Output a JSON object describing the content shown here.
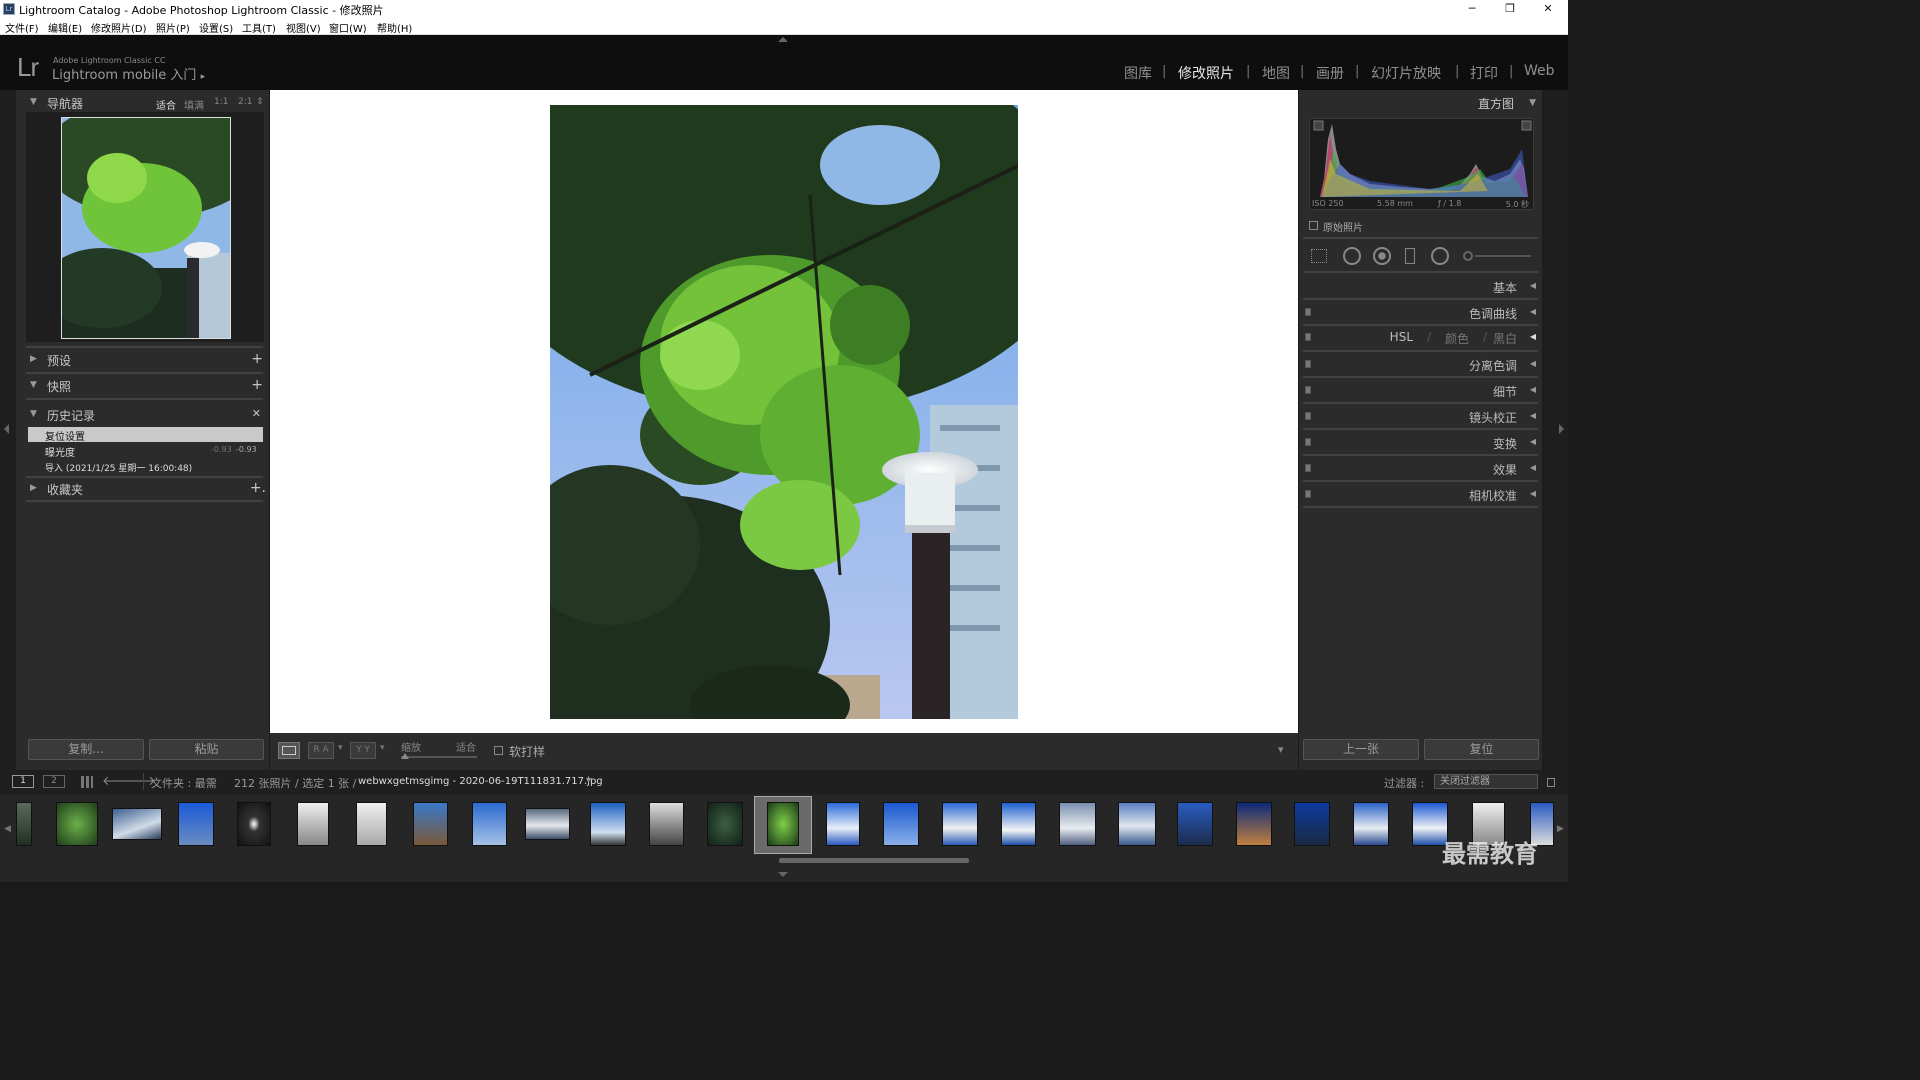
{
  "window": {
    "title": "Lightroom Catalog - Adobe Photoshop Lightroom Classic - 修改照片",
    "icon": "Lr",
    "min": "─",
    "restore": "❐",
    "close": "✕"
  },
  "menu": [
    "文件(F)",
    "编辑(E)",
    "修改照片(D)",
    "照片(P)",
    "设置(S)",
    "工具(T)",
    "视图(V)",
    "窗口(W)",
    "帮助(H)"
  ],
  "identity": {
    "logo": "Lr",
    "line1": "Adobe Lightroom Classic CC",
    "line2": "Lightroom mobile 入门",
    "arrow": "▸"
  },
  "modules": [
    {
      "label": "图库",
      "active": false
    },
    {
      "label": "修改照片",
      "active": true
    },
    {
      "label": "地图",
      "active": false
    },
    {
      "label": "画册",
      "active": false
    },
    {
      "label": "幻灯片放映",
      "active": false
    },
    {
      "label": "打印",
      "active": false
    },
    {
      "label": "Web",
      "active": false
    }
  ],
  "module_sep": "|",
  "navigator": {
    "title": "导航器",
    "zoom": [
      "适合",
      "填满",
      "1:1",
      "2:1"
    ],
    "zoom_arrows": "⇕"
  },
  "presets": {
    "title": "预设",
    "action": "+"
  },
  "snapshots": {
    "title": "快照",
    "action": "+"
  },
  "history": {
    "title": "历史记录",
    "action": "✕",
    "items": [
      {
        "label": "复位设置",
        "v1": "",
        "v2": "",
        "selected": true
      },
      {
        "label": "曝光度",
        "v1": "-0.93",
        "v2": "-0.93",
        "selected": false
      },
      {
        "label": "导入 (2021/1/25 星期一 16:00:48)",
        "v1": "",
        "v2": "",
        "selected": false
      }
    ]
  },
  "collections": {
    "title": "收藏夹",
    "action": "+."
  },
  "left_buttons": {
    "copy": "复制...",
    "paste": "粘贴"
  },
  "histogram": {
    "title": "直方图",
    "iso": "ISO 250",
    "focal": "5.58 mm",
    "aperture": "ƒ / 1.8",
    "shutter": "5.0 秒",
    "original": "原始照片"
  },
  "right_panels": [
    "基本",
    "色调曲线",
    "分离色调",
    "细节",
    "镜头校正",
    "变换",
    "效果",
    "相机校准"
  ],
  "hsl": {
    "hsl": "HSL",
    "color": "颜色",
    "bw": "黑白",
    "slash": "/"
  },
  "right_buttons": {
    "prev": "上一张",
    "reset": "复位"
  },
  "toolbar": {
    "zoom_label": "缩放",
    "fit": "适合",
    "softproof": "软打样",
    "ra": "R A",
    "yy": "Y Y",
    "dropdown": "▾"
  },
  "filmbar": {
    "page1": "1",
    "page2": "2",
    "source": "文件夹 : 最需",
    "count": "212 张照片 / 选定 1 张 /",
    "filename": "webwxgetmsgimg - 2020-06-19T111831.717.jpg",
    "filter_label": "过滤器 :",
    "filter_value": "关闭过滤器",
    "dropdown": "▾"
  },
  "watermark": "最需教育",
  "colors": {
    "accent": "#e8e8e8",
    "panel": "#2b2b2b",
    "bg": "#1a1a1a"
  }
}
